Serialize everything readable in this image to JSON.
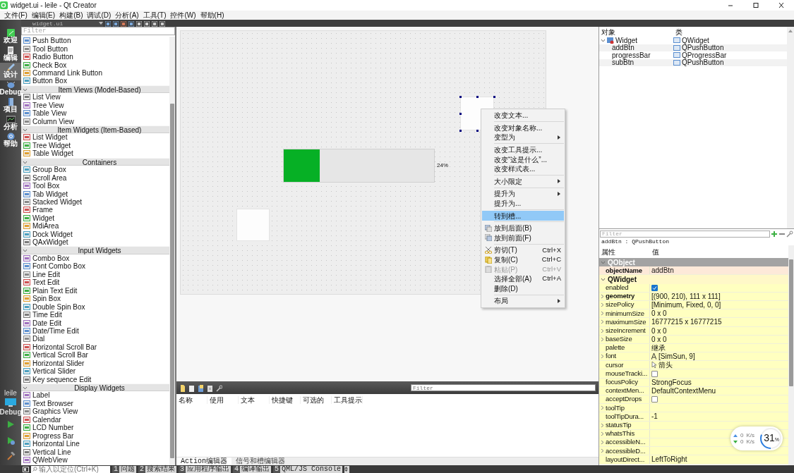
{
  "window": {
    "title": "widget.ui - leile - Qt Creator"
  },
  "menu": [
    "文件(F)",
    "编辑(E)",
    "构建(B)",
    "调试(D)",
    "分析(A)",
    "工具(T)",
    "控件(W)",
    "帮助(H)"
  ],
  "modes": [
    {
      "label": "欢迎",
      "selected": false
    },
    {
      "label": "编辑",
      "selected": false
    },
    {
      "label": "设计",
      "selected": true
    },
    {
      "label": "Debug",
      "selected": false
    },
    {
      "label": "项目",
      "selected": false
    },
    {
      "label": "分析",
      "selected": false
    },
    {
      "label": "帮助",
      "selected": false
    }
  ],
  "kit": {
    "project": "leile",
    "config": "Debug"
  },
  "editor_toolbar": {
    "file": "widget.ui"
  },
  "widget_box": {
    "filter_placeholder": "Filter",
    "groups": [
      {
        "items": [
          "Push Button",
          "Tool Button",
          "Radio Button",
          "Check Box",
          "Command Link Button",
          "Button Box"
        ]
      },
      {
        "header": "Item Views (Model-Based)",
        "expanded": true,
        "items": [
          "List View",
          "Tree View",
          "Table View",
          "Column View"
        ]
      },
      {
        "header": "Item Widgets (Item-Based)",
        "expanded": true,
        "items": [
          "List Widget",
          "Tree Widget",
          "Table Widget"
        ]
      },
      {
        "header": "Containers",
        "expanded": true,
        "items": [
          "Group Box",
          "Scroll Area",
          "Tool Box",
          "Tab Widget",
          "Stacked Widget",
          "Frame",
          "Widget",
          "MdiArea",
          "Dock Widget",
          "QAxWidget"
        ]
      },
      {
        "header": "Input Widgets",
        "expanded": true,
        "items": [
          "Combo Box",
          "Font Combo Box",
          "Line Edit",
          "Text Edit",
          "Plain Text Edit",
          "Spin Box",
          "Double Spin Box",
          "Time Edit",
          "Date Edit",
          "Date/Time Edit",
          "Dial",
          "Horizontal Scroll Bar",
          "Vertical Scroll Bar",
          "Horizontal Slider",
          "Vertical Slider",
          "Key sequence Edit"
        ]
      },
      {
        "header": "Display Widgets",
        "expanded": true,
        "items": [
          "Label",
          "Text Browser",
          "Graphics View",
          "Calendar",
          "LCD Number",
          "Progress Bar",
          "Horizontal Line",
          "Vertical Line",
          "QWebView"
        ]
      }
    ]
  },
  "form": {
    "progress_bar": {
      "level": 0.24,
      "reading": "24%"
    }
  },
  "context_menu": {
    "sections": [
      [
        {
          "label": "改变文本...",
          "icon": false,
          "submenu": false,
          "selected": false,
          "disabled": false
        }
      ],
      [
        {
          "label": "改变对象名称...",
          "icon": false,
          "submenu": false,
          "selected": false,
          "disabled": false
        },
        {
          "label": "变型为",
          "icon": false,
          "submenu": true,
          "selected": false,
          "disabled": false
        }
      ],
      [
        {
          "label": "改变工具提示...",
          "icon": false,
          "submenu": false,
          "selected": false,
          "disabled": false
        },
        {
          "label": "改变“这是什么”...",
          "icon": false,
          "submenu": false,
          "selected": false,
          "disabled": false
        },
        {
          "label": "改变样式表...",
          "icon": false,
          "submenu": false,
          "selected": false,
          "disabled": false
        }
      ],
      [
        {
          "label": "大小限定",
          "icon": false,
          "submenu": true,
          "selected": false,
          "disabled": false
        }
      ],
      [
        {
          "label": "提升为",
          "icon": false,
          "submenu": true,
          "selected": false,
          "disabled": false
        },
        {
          "label": "提升为...",
          "icon": false,
          "submenu": false,
          "selected": false,
          "disabled": false
        }
      ],
      [
        {
          "label": "转到槽...",
          "icon": false,
          "submenu": false,
          "selected": true,
          "disabled": false
        }
      ],
      [
        {
          "label": "放到后面(B)",
          "icon": true,
          "submenu": false,
          "selected": false,
          "disabled": false
        },
        {
          "label": "放到前面(F)",
          "icon": true,
          "submenu": false,
          "selected": false,
          "disabled": false
        }
      ],
      [
        {
          "label": "剪切(T)",
          "shortcut": "Ctrl+X",
          "icon": true,
          "submenu": false,
          "selected": false,
          "disabled": false
        },
        {
          "label": "复制(C)",
          "shortcut": "Ctrl+C",
          "icon": true,
          "submenu": false,
          "selected": false,
          "disabled": false
        },
        {
          "label": "粘贴(P)",
          "shortcut": "Ctrl+V",
          "icon": true,
          "submenu": false,
          "selected": false,
          "disabled": true
        },
        {
          "label": "选择全部(A)",
          "shortcut": "Ctrl+A",
          "icon": false,
          "submenu": false,
          "selected": false,
          "disabled": false
        },
        {
          "label": "删除(D)",
          "icon": false,
          "submenu": false,
          "selected": false,
          "disabled": false
        }
      ],
      [
        {
          "label": "布局",
          "icon": false,
          "submenu": true,
          "selected": false,
          "disabled": false
        }
      ]
    ]
  },
  "action_editor": {
    "filter_placeholder": "Filter",
    "columns": [
      "名称",
      "使用",
      "文本",
      "快捷键",
      "可选的",
      "工具提示"
    ],
    "tabs": [
      {
        "label": "Action编辑器",
        "selected": true
      },
      {
        "label": "信号和槽编辑器",
        "selected": false
      }
    ]
  },
  "object_inspector": {
    "columns": [
      "对象",
      "类"
    ],
    "tree": [
      {
        "name": "Widget",
        "class": "QWidget",
        "expanded": true,
        "children": [
          {
            "name": "addBtn",
            "class": "QPushButton"
          },
          {
            "name": "progressBar",
            "class": "QProgressBar"
          },
          {
            "name": "subBtn",
            "class": "QPushButton"
          }
        ]
      }
    ]
  },
  "property_editor": {
    "filter_placeholder": "Filter",
    "caption": "addBtn : QPushButton",
    "columns": [
      "属性",
      "值"
    ],
    "groups": [
      {
        "name": "QObject",
        "selected": true,
        "color": "#fde9d9",
        "rows": [
          {
            "kind": "text",
            "name": "objectName",
            "value": "addBtn",
            "modified": true,
            "expandable": false
          }
        ]
      },
      {
        "name": "QWidget",
        "selected": false,
        "color": "#ffffc0",
        "rows": [
          {
            "kind": "checkbox",
            "name": "enabled",
            "checked": true,
            "modified": false,
            "expandable": false
          },
          {
            "kind": "text",
            "name": "geometry",
            "value": "[(900, 210), 111 x 111]",
            "modified": true,
            "expandable": true
          },
          {
            "kind": "text",
            "name": "sizePolicy",
            "value": "[Minimum, Fixed, 0, 0]",
            "modified": false,
            "expandable": true
          },
          {
            "kind": "text",
            "name": "minimumSize",
            "value": "0 x 0",
            "modified": false,
            "expandable": true
          },
          {
            "kind": "text",
            "name": "maximumSize",
            "value": "16777215 x 16777215",
            "modified": false,
            "expandable": true
          },
          {
            "kind": "text",
            "name": "sizeIncrement",
            "value": "0 x 0",
            "modified": false,
            "expandable": true
          },
          {
            "kind": "text",
            "name": "baseSize",
            "value": "0 x 0",
            "modified": false,
            "expandable": true
          },
          {
            "kind": "text",
            "name": "palette",
            "value": "继承",
            "modified": false,
            "expandable": false
          },
          {
            "kind": "font",
            "name": "font",
            "value": "[SimSun, 9]",
            "modified": false,
            "expandable": true
          },
          {
            "kind": "cursor",
            "name": "cursor",
            "value": "箭头",
            "modified": false,
            "expandable": false
          },
          {
            "kind": "checkbox",
            "name": "mouseTracki...",
            "checked": false,
            "modified": false,
            "expandable": false
          },
          {
            "kind": "text",
            "name": "focusPolicy",
            "value": "StrongFocus",
            "modified": false,
            "expandable": false
          },
          {
            "kind": "text",
            "name": "contextMen...",
            "value": "DefaultContextMenu",
            "modified": false,
            "expandable": false
          },
          {
            "kind": "checkbox",
            "name": "acceptDrops",
            "checked": false,
            "modified": false,
            "expandable": false
          },
          {
            "kind": "text",
            "name": "toolTip",
            "modified": false,
            "expandable": true
          },
          {
            "kind": "text",
            "name": "toolTipDura...",
            "value": "-1",
            "modified": false,
            "expandable": false
          },
          {
            "kind": "text",
            "name": "statusTip",
            "modified": false,
            "expandable": true
          },
          {
            "kind": "text",
            "name": "whatsThis",
            "modified": false,
            "expandable": true
          },
          {
            "kind": "text",
            "name": "accessibleN...",
            "modified": false,
            "expandable": true
          },
          {
            "kind": "text",
            "name": "accessibleD...",
            "modified": false,
            "expandable": true
          },
          {
            "kind": "text",
            "name": "layoutDirect...",
            "value": "LeftToRight",
            "modified": false,
            "expandable": false
          }
        ]
      }
    ]
  },
  "status_bar": {
    "search_placeholder": "输入以定位(Ctrl+K)",
    "panes": [
      {
        "number": "1",
        "label": "问题"
      },
      {
        "number": "2",
        "label": "搜索结果"
      },
      {
        "number": "3",
        "label": "应用程序输出"
      },
      {
        "number": "4",
        "label": "编译输出"
      },
      {
        "number": "5",
        "label": "QML/JS Console"
      }
    ]
  },
  "net_meter": {
    "up": "0",
    "up_unit": "K/s",
    "down": "0",
    "down_unit": "K/s",
    "cpu": "31",
    "cpu_unit": "%"
  }
}
